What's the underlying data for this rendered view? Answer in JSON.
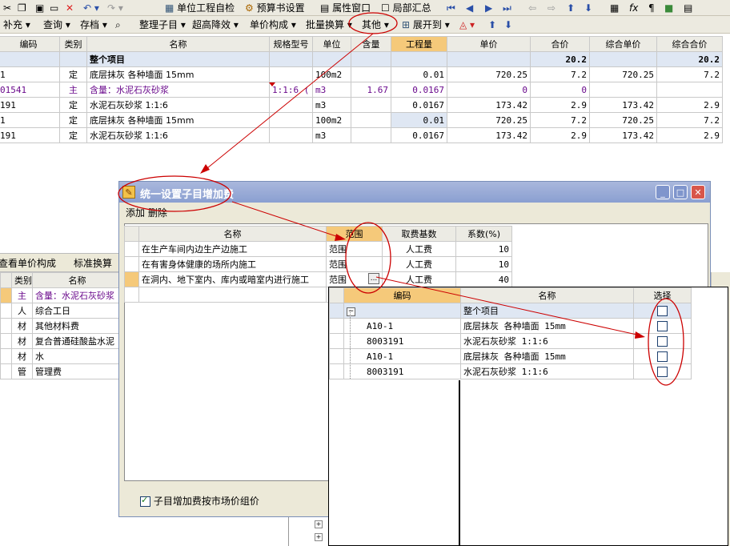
{
  "toolbar1": {
    "items": [
      {
        "label": "单位工程自检"
      },
      {
        "label": "预算书设置"
      },
      {
        "label": "属性窗口"
      },
      {
        "label": "局部汇总"
      }
    ]
  },
  "toolbar2": {
    "items": [
      {
        "label": "补充 ▾"
      },
      {
        "label": "查询 ▾"
      },
      {
        "label": "存档 ▾"
      },
      {
        "label": "整理子目 ▾"
      },
      {
        "label": "超高降效 ▾"
      },
      {
        "label": "单价构成 ▾"
      },
      {
        "label": "批量换算 ▾"
      },
      {
        "label": "其他 ▾"
      },
      {
        "label": "展开到 ▾"
      }
    ]
  },
  "main_grid": {
    "headers": [
      "编码",
      "类别",
      "名称",
      "规格型号",
      "单位",
      "含量",
      "工程量",
      "单价",
      "合价",
      "综合单价",
      "综合合价"
    ],
    "rows": [
      {
        "code": "",
        "type": "",
        "name": "整个项目",
        "spec": "",
        "unit": "",
        "content": "",
        "qty": "",
        "price": "",
        "total": "20.2",
        "comp_price": "",
        "comp_total": "20.2"
      },
      {
        "code": "1",
        "type": "定",
        "name": "底层抹灰 各种墙面 15mm",
        "spec": "",
        "unit": "100m2",
        "content": "",
        "qty": "0.01",
        "price": "720.25",
        "total": "7.2",
        "comp_price": "720.25",
        "comp_total": "7.2"
      },
      {
        "code": "01541",
        "type": "主",
        "name": "含量：水泥石灰砂浆",
        "spec": "1:1:6 (",
        "unit": "m3",
        "content": "1.67",
        "qty": "0.0167",
        "price": "0",
        "total": "0",
        "comp_price": "",
        "comp_total": ""
      },
      {
        "code": "191",
        "type": "定",
        "name": "水泥石灰砂浆 1:1:6",
        "spec": "",
        "unit": "m3",
        "content": "",
        "qty": "0.0167",
        "price": "173.42",
        "total": "2.9",
        "comp_price": "173.42",
        "comp_total": "2.9"
      },
      {
        "code": "1",
        "type": "定",
        "name": "底层抹灰 各种墙面 15mm",
        "spec": "",
        "unit": "100m2",
        "content": "",
        "qty": "0.01",
        "price": "720.25",
        "total": "7.2",
        "comp_price": "720.25",
        "comp_total": "7.2"
      },
      {
        "code": "191",
        "type": "定",
        "name": "水泥石灰砂浆 1:1:6",
        "spec": "",
        "unit": "m3",
        "content": "",
        "qty": "0.0167",
        "price": "173.42",
        "total": "2.9",
        "comp_price": "173.42",
        "comp_total": "2.9"
      }
    ]
  },
  "lower_panel": {
    "tabs": [
      {
        "label": "查看单价构成"
      },
      {
        "label": "标准换算"
      }
    ],
    "headers": [
      "类别",
      "名称"
    ],
    "rows": [
      {
        "type": "主",
        "name": "含量：水泥石灰砂浆"
      },
      {
        "type": "人",
        "name": "综合工日"
      },
      {
        "type": "材",
        "name": "其他材料费"
      },
      {
        "type": "材",
        "name": "复合普通硅酸盐水泥"
      },
      {
        "type": "材",
        "name": "水"
      },
      {
        "type": "管",
        "name": "管理费"
      }
    ]
  },
  "dialog": {
    "title": "统一设置子目增加费",
    "menu": {
      "add": "添加",
      "delete": "删除"
    },
    "headers": [
      "名称",
      "范围",
      "取费基数",
      "系数(%)"
    ],
    "rows": [
      {
        "name": "在生产车间内边生产边施工",
        "scope": "范围",
        "base": "人工费",
        "coef": "10"
      },
      {
        "name": "在有害身体健康的场所内施工",
        "scope": "范围",
        "base": "人工费",
        "coef": "10"
      },
      {
        "name": "在洞内、地下室内、库内或暗室内进行施工",
        "scope": "范围",
        "base": "人工费",
        "coef": "40"
      }
    ],
    "ellipsis": "...",
    "checkbox_label": "子目增加费按市场价组价",
    "checkbox_checked": true
  },
  "popup": {
    "headers": [
      "编码",
      "名称",
      "选择"
    ],
    "rows": [
      {
        "code": "",
        "name": "整个项目",
        "checked": false
      },
      {
        "code": "A10-1",
        "name": "底层抹灰 各种墙面 15mm",
        "checked": false
      },
      {
        "code": "8003191",
        "name": "水泥石灰砂浆 1:1:6",
        "checked": false
      },
      {
        "code": "A10-1",
        "name": "底层抹灰 各种墙面 15mm",
        "checked": false
      },
      {
        "code": "8003191",
        "name": "水泥石灰砂浆 1:1:6",
        "checked": false
      }
    ]
  },
  "colors": {
    "annotation": "#cc0000",
    "highlight": "#f5c97a",
    "title_bar": "#8a9fd1"
  }
}
